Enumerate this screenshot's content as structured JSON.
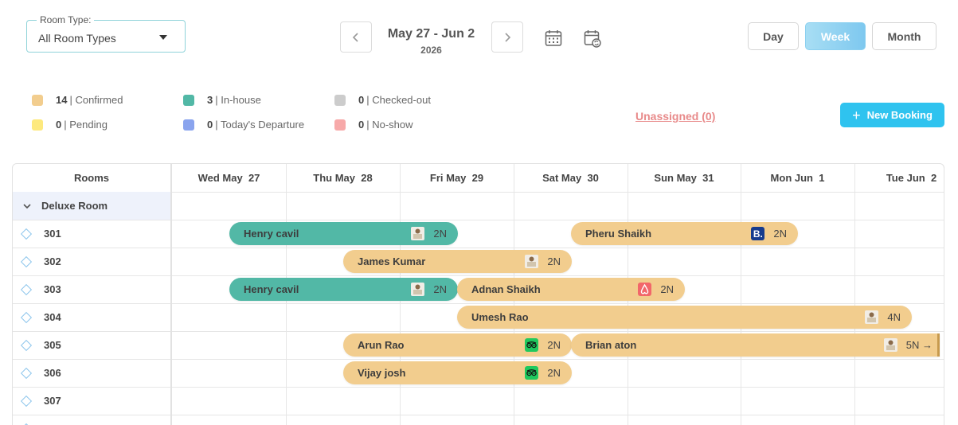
{
  "filter": {
    "label": "Room Type:",
    "value": "All Room Types"
  },
  "date_nav": {
    "range": "May 27 - Jun 2",
    "year": "2026"
  },
  "views": {
    "day": "Day",
    "week": "Week",
    "month": "Month",
    "active": "Week"
  },
  "status_legend": [
    {
      "count": "14",
      "label": "| Confirmed",
      "color": "#f2cd8e"
    },
    {
      "count": "0",
      "label": "| Pending",
      "color": "#fde97e"
    },
    {
      "count": "3",
      "label": "| In-house",
      "color": "#52b8a6"
    },
    {
      "count": "0",
      "label": "| Today's Departure",
      "color": "#8aa4ee"
    },
    {
      "count": "0",
      "label": "| Checked-out",
      "color": "#cccccc"
    },
    {
      "count": "0",
      "label": "| No-show",
      "color": "#f7a9a9"
    }
  ],
  "unassigned": "Unassigned (0)",
  "new_booking": "New Booking",
  "grid": {
    "rooms_header": "Rooms",
    "days": [
      {
        "dow": "Wed May",
        "day": "27"
      },
      {
        "dow": "Thu May",
        "day": "28"
      },
      {
        "dow": "Fri May",
        "day": "29"
      },
      {
        "dow": "Sat May",
        "day": "30"
      },
      {
        "dow": "Sun May",
        "day": "31"
      },
      {
        "dow": "Mon Jun",
        "day": "1"
      },
      {
        "dow": "Tue Jun",
        "day": "2"
      }
    ],
    "group": "Deluxe Room",
    "rooms": [
      "301",
      "302",
      "303",
      "304",
      "305",
      "306",
      "307"
    ]
  },
  "bookings": [
    {
      "guest": "Henry cavil",
      "nights": "2N",
      "status": "in-house",
      "source": "front-desk-icon",
      "room": "301",
      "start_day": "Wed May 27",
      "end_day": "Fri May 29"
    },
    {
      "guest": "Pheru Shaikh",
      "nights": "2N",
      "status": "confirmed",
      "source": "booking-com-icon",
      "room": "301",
      "start_day": "Sat May 30",
      "end_day": "Mon Jun 1"
    },
    {
      "guest": "James Kumar",
      "nights": "2N",
      "status": "confirmed",
      "source": "front-desk-icon",
      "room": "302",
      "start_day": "Thu May 28",
      "end_day": "Sat May 30"
    },
    {
      "guest": "Henry cavil",
      "nights": "2N",
      "status": "in-house",
      "source": "front-desk-icon",
      "room": "303",
      "start_day": "Wed May 27",
      "end_day": "Fri May 29"
    },
    {
      "guest": "Adnan Shaikh",
      "nights": "2N",
      "status": "confirmed",
      "source": "airbnb-icon",
      "room": "303",
      "start_day": "Fri May 29",
      "end_day": "Sun May 31"
    },
    {
      "guest": "Umesh Rao",
      "nights": "4N",
      "status": "confirmed",
      "source": "front-desk-icon",
      "room": "304",
      "start_day": "Fri May 29",
      "end_day": "Tue Jun 2"
    },
    {
      "guest": "Arun Rao",
      "nights": "2N",
      "status": "confirmed",
      "source": "tripadvisor-icon",
      "room": "305",
      "start_day": "Thu May 28",
      "end_day": "Sat May 30"
    },
    {
      "guest": "Brian aton",
      "nights": "5N →",
      "status": "confirmed",
      "source": "front-desk-icon",
      "room": "305",
      "start_day": "Sat May 30",
      "end_day": ""
    },
    {
      "guest": "Vijay josh",
      "nights": "2N",
      "status": "confirmed",
      "source": "tripadvisor-icon",
      "room": "306",
      "start_day": "Thu May 28",
      "end_day": "Sat May 30"
    }
  ],
  "colors": {
    "accent": "#2fc3ef",
    "in_house": "#52b8a6",
    "confirmed": "#f2cd8e",
    "unassigned": "#e88a8a"
  }
}
